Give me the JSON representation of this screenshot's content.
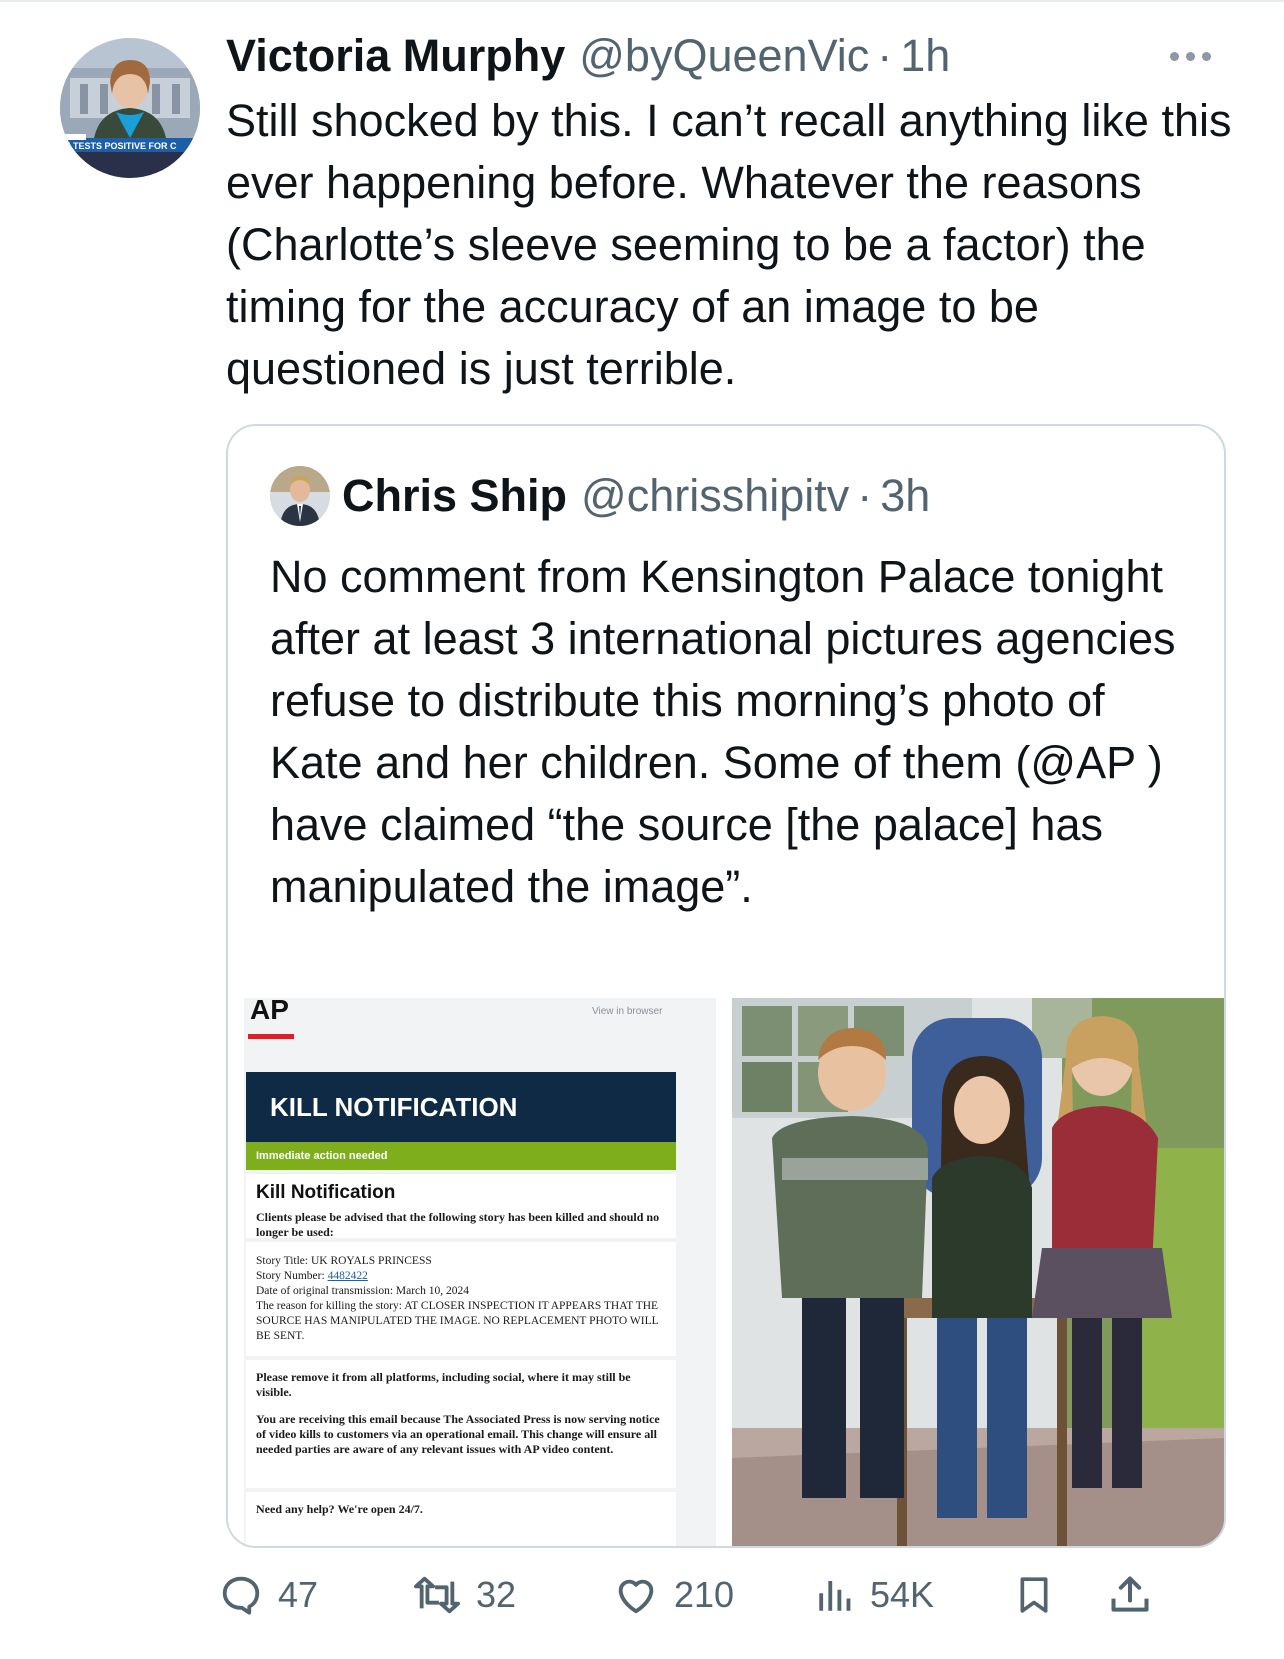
{
  "tweet": {
    "author_name": "Victoria Murphy",
    "author_handle": "@byQueenVic",
    "separator": "·",
    "time": "1h",
    "text": "Still shocked by this. I can’t recall anything like this ever happening before. Whatever the reasons (Charlotte’s sleeve seeming to be a factor) the timing for the accuracy of an image to be questioned is just terrible.",
    "avatar_caption": "N TESTS POSITIVE FOR C"
  },
  "quote": {
    "author_name": "Chris Ship",
    "author_handle": "@chrisshipitv",
    "separator": "·",
    "time": "3h",
    "text": "No comment from Kensington Palace tonight after at least 3 international pictures agencies refuse to distribute this morning’s photo of Kate and her children. Some of them (@AP ) have claimed “the source [the palace] has manipulated the image”."
  },
  "ap_doc": {
    "logo": "AP",
    "view_in_browser": "View in browser",
    "header": "KILL NOTIFICATION",
    "action_bar": "Immediate action needed",
    "title": "Kill Notification",
    "intro": "Clients please be advised that the following story has been killed and should no longer be used:",
    "story_title": "Story Title: UK ROYALS PRINCESS",
    "story_number_label": "Story Number: ",
    "story_number": "4482422",
    "date_line": "Date of original transmission: March 10, 2024",
    "reason": "The reason for killing the story: AT CLOSER INSPECTION IT APPEARS THAT THE SOURCE HAS MANIPULATED THE IMAGE. NO REPLACEMENT PHOTO WILL BE SENT.",
    "remove_note": "Please remove it from all platforms, including social, where it may still be visible.",
    "receiving_note": "You are receiving this email because The Associated Press is now serving notice of video kills to customers via an operational email. This change will ensure all needed parties are aware of any relevant issues with AP video content.",
    "help": "Need any help? We're open 24/7."
  },
  "actions": {
    "replies": "47",
    "retweets": "32",
    "likes": "210",
    "views": "54K"
  },
  "colors": {
    "text_primary": "#0f1419",
    "text_secondary": "#536471",
    "border": "#cfd9de",
    "ap_navy": "#0e2a45",
    "ap_green": "#7fae1d",
    "ap_red": "#e01e25"
  }
}
